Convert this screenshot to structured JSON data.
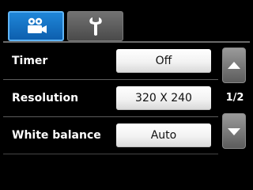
{
  "tabs": [
    {
      "name": "camera",
      "icon": "video-camera-icon",
      "selected": true
    },
    {
      "name": "settings",
      "icon": "wrench-icon",
      "selected": false
    }
  ],
  "settings": [
    {
      "label": "Timer",
      "value": "Off"
    },
    {
      "label": "Resolution",
      "value": "320 X 240"
    },
    {
      "label": "White balance",
      "value": "Auto"
    }
  ],
  "pager": {
    "indicator": "1/2",
    "up_icon": "arrow-up-icon",
    "down_icon": "arrow-down-icon"
  },
  "colors": {
    "selected_tab": "#1778c8",
    "unselected_tab": "#5e5e5e",
    "background": "#000000",
    "value_button": "#f2f2f2"
  }
}
